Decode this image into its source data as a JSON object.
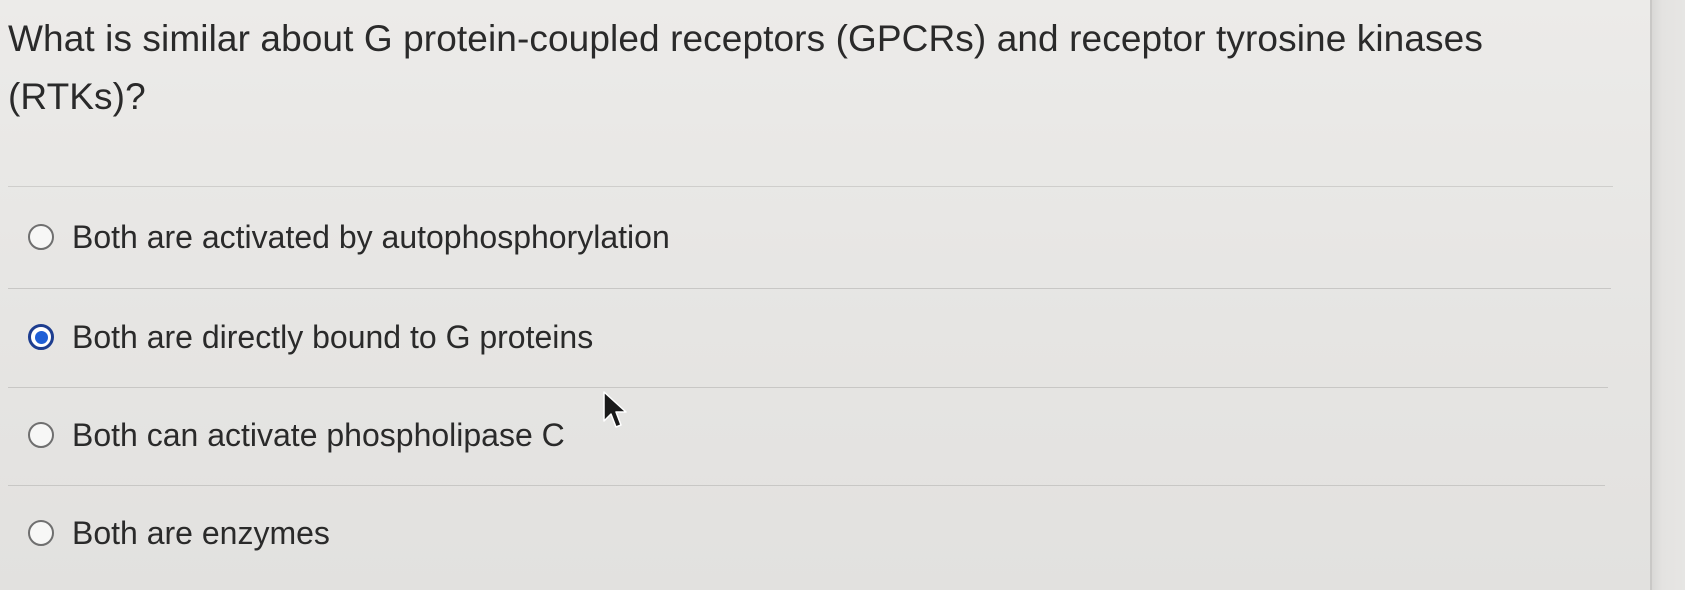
{
  "question": {
    "text": "What is similar about G protein-coupled receptors (GPCRs) and receptor tyrosine kinases (RTKs)?"
  },
  "options": [
    {
      "label": "Both are activated by autophosphorylation",
      "selected": false
    },
    {
      "label": "Both are directly bound to G proteins",
      "selected": true
    },
    {
      "label": "Both can activate phospholipase C",
      "selected": false
    },
    {
      "label": "Both are enzymes",
      "selected": false
    }
  ],
  "icons": {
    "radio_selected_color": "#1f5fd6",
    "radio_unselected_border": "#6f6f6f",
    "cursor": "arrow-cursor-icon"
  }
}
